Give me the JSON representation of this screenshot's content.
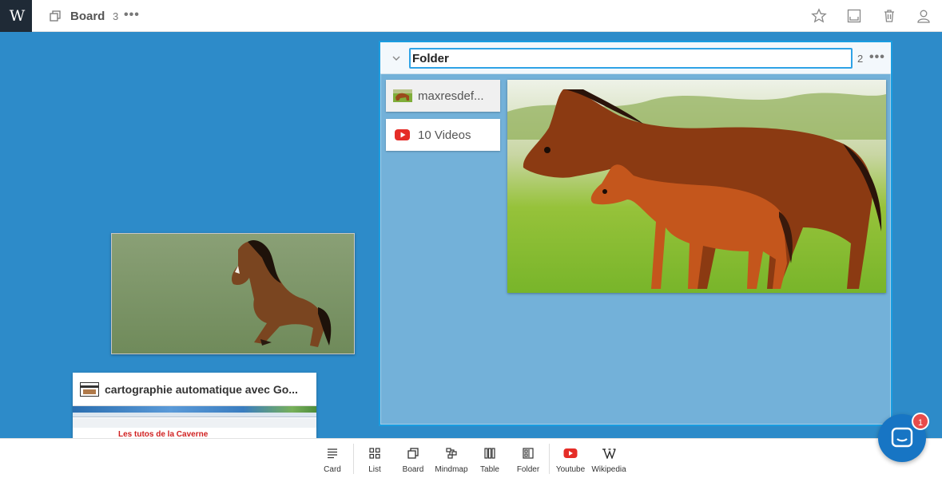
{
  "header": {
    "logo_text": "W",
    "board_title": "Board",
    "board_count": "3",
    "more": "•••"
  },
  "canvas": {
    "link_card": {
      "title": "cartographie automatique avec Go...",
      "preview_text": "Les tutos de la Caverne"
    }
  },
  "folder": {
    "title_value": "Folder",
    "count": "2",
    "more": "•••",
    "items": [
      {
        "label": "maxresdef..."
      },
      {
        "label": "10 Videos"
      }
    ]
  },
  "toolbar": {
    "items": [
      {
        "label": "Card"
      },
      {
        "label": "List"
      },
      {
        "label": "Board"
      },
      {
        "label": "Mindmap"
      },
      {
        "label": "Table"
      },
      {
        "label": "Folder"
      },
      {
        "label": "Youtube"
      },
      {
        "label": "Wikipedia"
      }
    ]
  },
  "chat": {
    "badge": "1"
  },
  "colors": {
    "canvas_bg": "#2d8bc9",
    "folder_bg": "#73b1d9",
    "folder_border": "#1a9de0",
    "logo_bg": "#1f2a36",
    "youtube_red": "#e52d27",
    "chat_blue": "#1775c4",
    "badge_red": "#e84b4b"
  }
}
